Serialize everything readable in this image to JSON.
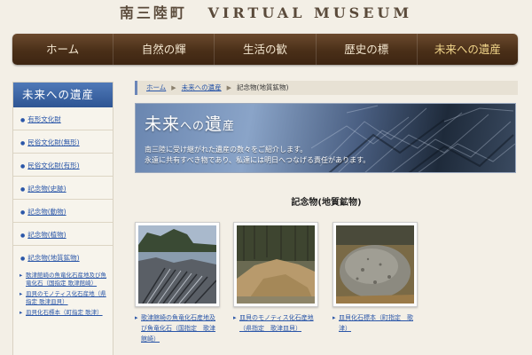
{
  "header": {
    "title_jp": "南三陸町",
    "title_en": "VIRTUAL MUSEUM"
  },
  "nav": {
    "items": [
      "ホーム",
      "自然の輝",
      "生活の歓",
      "歴史の標",
      "未来への遺産"
    ]
  },
  "sidebar": {
    "heading": "未来への遺産",
    "items": [
      {
        "label": "有形文化財"
      },
      {
        "label": "民俗文化財(無形)"
      },
      {
        "label": "民俗文化財(有形)"
      },
      {
        "label": "記念物(史跡)"
      },
      {
        "label": "記念物(動物)"
      },
      {
        "label": "記念物(植物)"
      },
      {
        "label": "記念物(地質鉱物)"
      }
    ],
    "subitems": [
      "歌津館崎の魚竜化石産地及び魚竜化石（国指定 歌津館崎）",
      "皿貝のモノティス化石産地（県指定 歌津皿貝）",
      "皿貝化石標本（町指定 歌津）"
    ]
  },
  "breadcrumb": {
    "home": "ホーム",
    "section": "未来への遺産",
    "current": "記念物(地質鉱物)"
  },
  "banner": {
    "title_big": "未来",
    "title_small": "への",
    "title_big2": "遺",
    "title_small2": "産",
    "desc_line1": "南三陸に受け継がれた遺産の数々をご紹介します。",
    "desc_line2": "永遠に共有すべき物であり、私達には明日へつなげる責任があります。"
  },
  "main": {
    "title": "記念物(地質鉱物)",
    "cards": [
      {
        "caption": "歌津館崎の魚竜化石産地及び魚竜化石（国指定　歌津館崎）"
      },
      {
        "caption": "皿貝のモノティス化石産地（県指定　歌津皿貝）"
      },
      {
        "caption": "皿貝化石標本（町指定　歌津）"
      }
    ]
  }
}
